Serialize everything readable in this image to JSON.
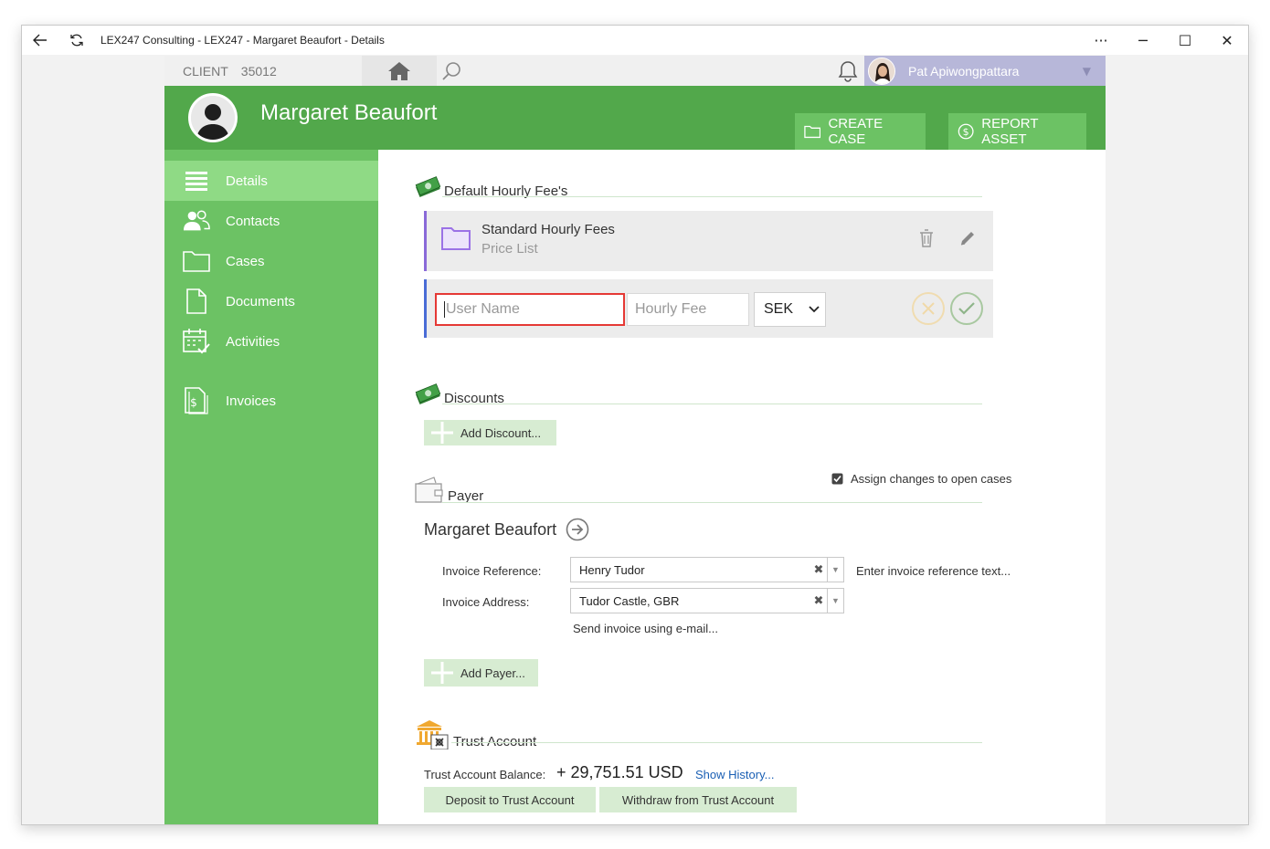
{
  "window": {
    "title": "LEX247 Consulting - LEX247 - Margaret Beaufort - Details",
    "controls": {
      "more": "···",
      "minimize": "─",
      "maximize": "☐",
      "close": "✕"
    }
  },
  "topbar": {
    "client_label": "CLIENT",
    "client_number": "35012",
    "user_name": "Pat Apiwongpattara"
  },
  "header": {
    "client_name": "Margaret Beaufort",
    "create_case": "CREATE CASE",
    "report_asset": "REPORT ASSET"
  },
  "sidebar": {
    "items": [
      {
        "label": "Details",
        "icon": "details-icon",
        "active": true
      },
      {
        "label": "Contacts",
        "icon": "contacts-icon"
      },
      {
        "label": "Cases",
        "icon": "folder-icon"
      },
      {
        "label": "Documents",
        "icon": "document-icon"
      },
      {
        "label": "Activities",
        "icon": "calendar-check-icon"
      },
      {
        "label": "Invoices",
        "icon": "invoice-icon"
      }
    ]
  },
  "fees": {
    "title": "Default Hourly Fee's",
    "card_title": "Standard Hourly Fees",
    "card_subtitle": "Price List",
    "username_placeholder": "User Name",
    "hourly_fee_placeholder": "Hourly Fee",
    "currency": "SEK"
  },
  "discounts": {
    "title": "Discounts",
    "add_label": "Add Discount..."
  },
  "payer": {
    "title": "Payer",
    "assign_label": "Assign changes to open cases",
    "assign_checked": true,
    "name": "Margaret Beaufort",
    "invoice_reference_label": "Invoice Reference:",
    "invoice_reference_value": "Henry Tudor",
    "invoice_reference_hint": "Enter invoice reference text...",
    "invoice_address_label": "Invoice Address:",
    "invoice_address_value": "Tudor Castle, GBR",
    "send_email": "Send invoice using e-mail...",
    "add_payer": "Add Payer..."
  },
  "trust": {
    "title": "Trust Account",
    "balance_label": "Trust Account Balance:",
    "balance_value": "+ 29,751.51 USD",
    "show_history": "Show History...",
    "deposit": "Deposit to Trust Account",
    "withdraw": "Withdraw from Trust Account"
  },
  "colors": {
    "header_green": "#52a84b",
    "sidebar_green": "#6cc264",
    "sidebar_active": "#8fda85",
    "light_button": "#d7ecd2",
    "user_area": "#b7b7d9",
    "fee_card_accent": "#8a6ad8",
    "edit_card_accent": "#4a6cd6",
    "focus_border": "#e53935",
    "link_blue": "#1a5fb4"
  }
}
